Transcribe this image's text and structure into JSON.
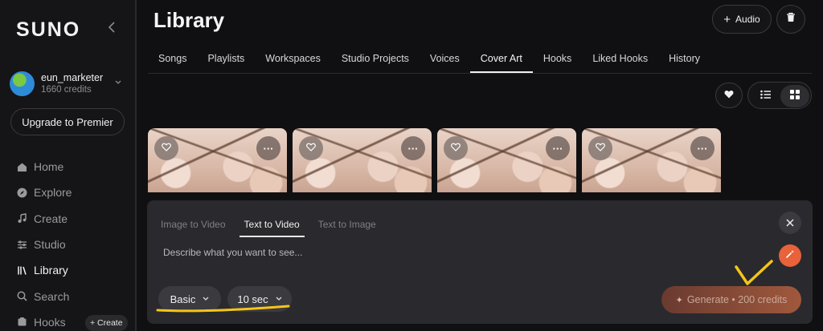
{
  "app": {
    "logo": "SUNO"
  },
  "user": {
    "name": "eun_marketer",
    "credits": "1660 credits"
  },
  "sidebar": {
    "upgrade_label": "Upgrade to Premier",
    "items": [
      {
        "label": "Home",
        "icon": "home-icon"
      },
      {
        "label": "Explore",
        "icon": "compass-icon"
      },
      {
        "label": "Create",
        "icon": "music-note-icon"
      },
      {
        "label": "Studio",
        "icon": "sliders-icon"
      },
      {
        "label": "Library",
        "icon": "library-icon"
      },
      {
        "label": "Search",
        "icon": "search-icon"
      },
      {
        "label": "Hooks",
        "icon": "hooks-icon"
      }
    ],
    "create_pill": "+ Create",
    "active": "Library"
  },
  "header": {
    "title": "Library",
    "audio_button": "Audio"
  },
  "tabs": [
    "Songs",
    "Playlists",
    "Workspaces",
    "Studio Projects",
    "Voices",
    "Cover Art",
    "Hooks",
    "Liked Hooks",
    "History"
  ],
  "active_tab": "Cover Art",
  "cards": [
    {
      "image": "cherry-blossom"
    },
    {
      "image": "cherry-blossom"
    },
    {
      "image": "cherry-blossom"
    },
    {
      "image": "cherry-blossom"
    }
  ],
  "composer": {
    "tabs": [
      "Image to Video",
      "Text to Video",
      "Text to Image"
    ],
    "active_tab": "Text to Video",
    "placeholder": "Describe what you want to see...",
    "quality": "Basic",
    "duration": "10 sec",
    "generate_label": "Generate • 200 credits"
  },
  "colors": {
    "accent": "#e8623a",
    "annotation": "#f5c518",
    "background": "#101012"
  }
}
